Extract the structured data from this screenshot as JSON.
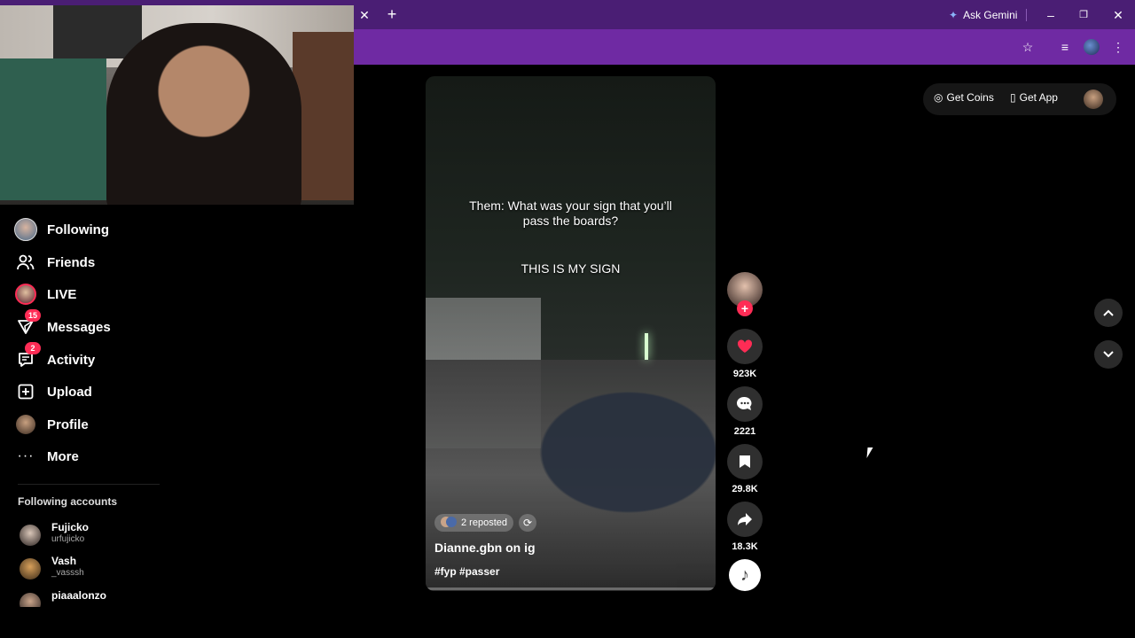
{
  "browser": {
    "tab_close": "✕",
    "new_tab": "+",
    "ask_gemini": "Ask Gemini",
    "minimize": "–",
    "restore": "❐",
    "close": "✕",
    "bookmark_icon": "☆",
    "media_icon": "≡",
    "menu_icon": "⋮"
  },
  "sidebar": {
    "items": [
      {
        "label": "Following",
        "icon": "following-avatar"
      },
      {
        "label": "Friends",
        "icon": "friends-icon"
      },
      {
        "label": "LIVE",
        "icon": "live-avatar"
      },
      {
        "label": "Messages",
        "icon": "messages-icon",
        "badge": "15"
      },
      {
        "label": "Activity",
        "icon": "activity-icon",
        "badge": "2"
      },
      {
        "label": "Upload",
        "icon": "upload-icon"
      },
      {
        "label": "Profile",
        "icon": "profile-avatar"
      },
      {
        "label": "More",
        "icon": "more-icon"
      }
    ],
    "following_title": "Following accounts",
    "accounts": [
      {
        "name": "Fujicko",
        "handle": "urfujicko"
      },
      {
        "name": "Vash",
        "handle": "_vasssh"
      },
      {
        "name": "piaaalonzo",
        "handle": ""
      }
    ]
  },
  "video": {
    "caption_line": "Them: What was your sign that you’ll pass the boards?",
    "caption_sign": "THIS IS MY SIGN",
    "reposted": "2 reposted",
    "author": "Dianne.gbn on ig",
    "hashtags": "#fyp #passer"
  },
  "actions": {
    "likes": "923K",
    "comments": "2221",
    "saves": "29.8K",
    "shares": "18.3K"
  },
  "topright": {
    "get_coins": "Get Coins",
    "get_app": "Get App"
  },
  "colors": {
    "accent": "#fe2c55",
    "titlebar": "#4a1e74",
    "addressbar": "#6f2aa3"
  }
}
